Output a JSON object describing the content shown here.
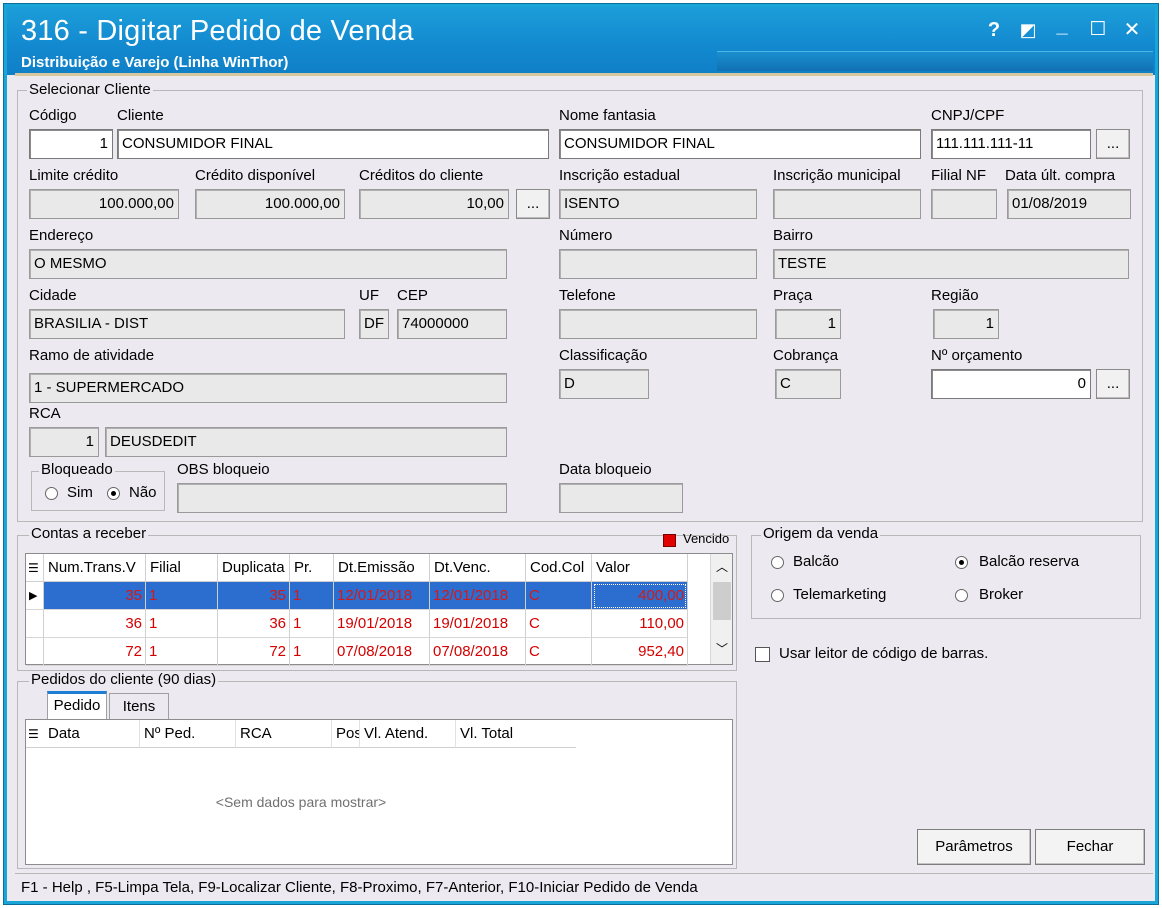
{
  "window": {
    "title": "316 - Digitar Pedido de Venda",
    "subtitle": "Distribuição e Varejo (Linha WinThor)",
    "controls": {
      "help": "?",
      "restore_alt": "◩",
      "minimize": "_",
      "maximize": "☐",
      "close": "✕"
    }
  },
  "cliente": {
    "group_label": "Selecionar Cliente",
    "codigo_label": "Código",
    "codigo": "1",
    "cliente_label": "Cliente",
    "cliente": "CONSUMIDOR FINAL",
    "nome_fantasia_label": "Nome fantasia",
    "nome_fantasia": "CONSUMIDOR FINAL",
    "cnpj_label": "CNPJ/CPF",
    "cnpj": "111.111.111-11",
    "limite_label": "Limite crédito",
    "limite": "100.000,00",
    "disponivel_label": "Crédito disponível",
    "disponivel": "100.000,00",
    "creditos_label": "Créditos do cliente",
    "creditos": "10,00",
    "ie_label": "Inscrição estadual",
    "ie": "ISENTO",
    "im_label": "Inscrição municipal",
    "im": "",
    "filial_label": "Filial NF",
    "filial": "",
    "data_compra_label": "Data últ. compra",
    "data_compra": "01/08/2019",
    "endereco_label": "Endereço",
    "endereco": "O MESMO",
    "numero_label": "Número",
    "numero": "",
    "bairro_label": "Bairro",
    "bairro": "TESTE",
    "cidade_label": "Cidade",
    "cidade": "BRASILIA - DIST",
    "uf_label": "UF",
    "uf": "DF",
    "cep_label": "CEP",
    "cep": "74000000",
    "telefone_label": "Telefone",
    "telefone": "",
    "praca_label": "Praça",
    "praca": "1",
    "regiao_label": "Região",
    "regiao": "1",
    "ramo_label": "Ramo de atividade",
    "ramo": "1 - SUPERMERCADO",
    "classificacao_label": "Classificação",
    "classificacao": "D",
    "cobranca_label": "Cobrança",
    "cobranca": "C",
    "orcamento_label": "Nº orçamento",
    "orcamento": "0",
    "rca_label": "RCA",
    "rca_codigo": "1",
    "rca_nome": "DEUSDEDIT",
    "bloqueado_label": "Bloqueado",
    "sim": "Sim",
    "nao": "Não",
    "obs_label": "OBS bloqueio",
    "obs": "",
    "data_bloqueio_label": "Data bloqueio",
    "data_bloqueio": "",
    "dots": "..."
  },
  "contas": {
    "group_label": "Contas a receber",
    "vencido_label": "Vencido",
    "vencido_color": "#e00000",
    "columns": [
      "Num.Trans.V",
      "Filial",
      "Duplicata",
      "Pr.",
      "Dt.Emissão",
      "Dt.Venc.",
      "Cod.Col",
      "Valor"
    ],
    "rows": [
      [
        "35",
        "1",
        "35",
        "1",
        "12/01/2018",
        "12/01/2018",
        "C",
        "400,00"
      ],
      [
        "36",
        "1",
        "36",
        "1",
        "19/01/2018",
        "19/01/2018",
        "C",
        "110,00"
      ],
      [
        "72",
        "1",
        "72",
        "1",
        "07/08/2018",
        "07/08/2018",
        "C",
        "952,40"
      ]
    ]
  },
  "origem": {
    "group_label": "Origem da venda",
    "balcao": "Balcão",
    "balcao_reserva": "Balcão reserva",
    "telemarketing": "Telemarketing",
    "broker": "Broker",
    "leitor": "Usar leitor de código de barras."
  },
  "pedidos": {
    "group_label": "Pedidos do cliente (90 dias)",
    "tabs": [
      "Pedido",
      "Itens"
    ],
    "columns": [
      "Data",
      "Nº Ped.",
      "RCA",
      "Pos",
      "Vl. Atend.",
      "Vl. Total"
    ],
    "empty": "<Sem dados para mostrar>"
  },
  "buttons": {
    "parametros": "Parâmetros",
    "fechar": "Fechar"
  },
  "status": "F1 - Help , F5-Limpa Tela, F9-Localizar Cliente, F8-Proximo, F7-Anterior, F10-Iniciar Pedido de Venda"
}
